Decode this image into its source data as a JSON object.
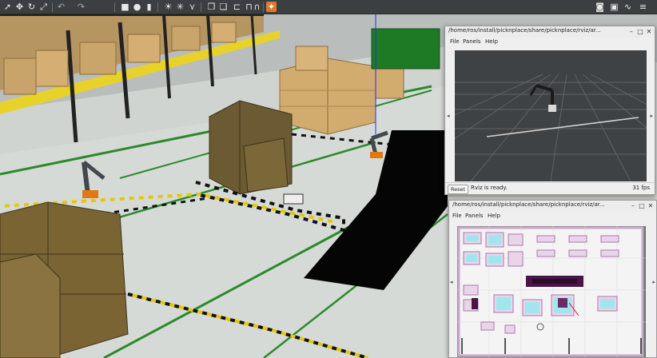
{
  "toolbar": {
    "left_icons": [
      "cursor-arrow-icon",
      "move-icon",
      "rotate-icon",
      "scale-icon",
      "undo-icon",
      "redo-icon",
      "box-shape-icon",
      "sphere-shape-icon",
      "cylinder-shape-icon",
      "sun-light-icon",
      "point-light-icon",
      "spot-light-icon",
      "copy-icon",
      "paste-icon",
      "align-icon",
      "snap-icon",
      "headphones-icon",
      "orange-model-icon"
    ],
    "right_icons": [
      "camera-icon",
      "record-icon",
      "graph-icon",
      "menu-icon"
    ]
  },
  "rviz_window": {
    "title": "/home/ros/install/picknplace/share/picknplace/rviz/ar...",
    "menus": [
      "File",
      "Panels",
      "Help"
    ],
    "reset_label": "Reset",
    "status": "Rviz is ready.",
    "fps": "31 fps"
  },
  "map_window": {
    "title": "/home/ros/install/picknplace/share/picknplace/rviz/ar...",
    "menus": [
      "File",
      "Panels",
      "Help"
    ]
  },
  "colors": {
    "toolbar_bg": "#3c3f41",
    "floor": "#d7dbd8",
    "grid_bg": "#3f4244",
    "map_purple": "#5c1e5c",
    "map_cyan": "#8fe0e8"
  }
}
